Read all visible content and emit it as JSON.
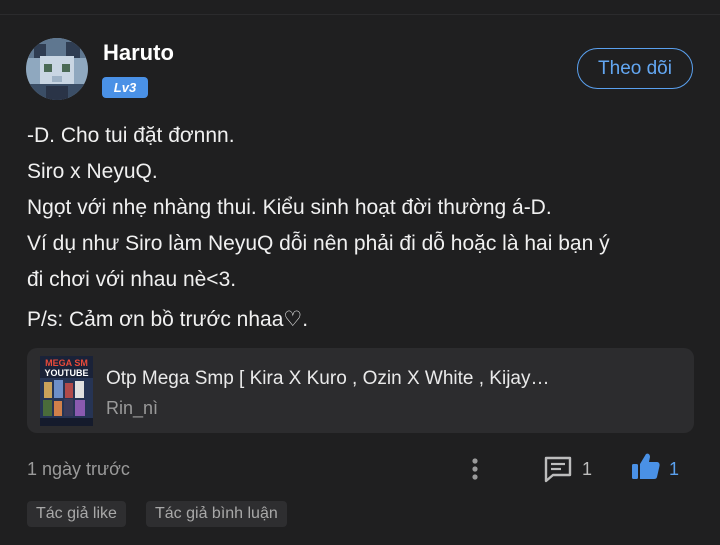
{
  "author": {
    "name": "Haruto",
    "level": "Lv3",
    "follow_label": "Theo dõi"
  },
  "post": {
    "lines": [
      "-D. Cho tui đặt đơnnn.",
      "Siro x NeyuQ.",
      "Ngọt với nhẹ nhàng thui. Kiểu sinh hoạt đời thường á-D.",
      "Ví dụ như Siro làm NeyuQ dỗi nên phải đi dỗ hoặc là hai bạn ý",
      "đi chơi với nhau nè<3.",
      "P/s: Cảm ơn bồ trước nhaa♡."
    ]
  },
  "linked_story": {
    "title": "Otp Mega Smp [ Kira X Kuro , Ozin X White , Kijay…",
    "author": "Rin_nì",
    "thumbnail_text": [
      "MEGA SM",
      "YOUTUBE"
    ]
  },
  "footer": {
    "time": "1 ngày trước",
    "comment_count": "1",
    "like_count": "1"
  },
  "tags": [
    "Tác giả like",
    "Tác giả bình luận"
  ],
  "colors": {
    "background": "#1f1f20",
    "accent": "#4a91e6",
    "card": "#2c2c2e"
  }
}
